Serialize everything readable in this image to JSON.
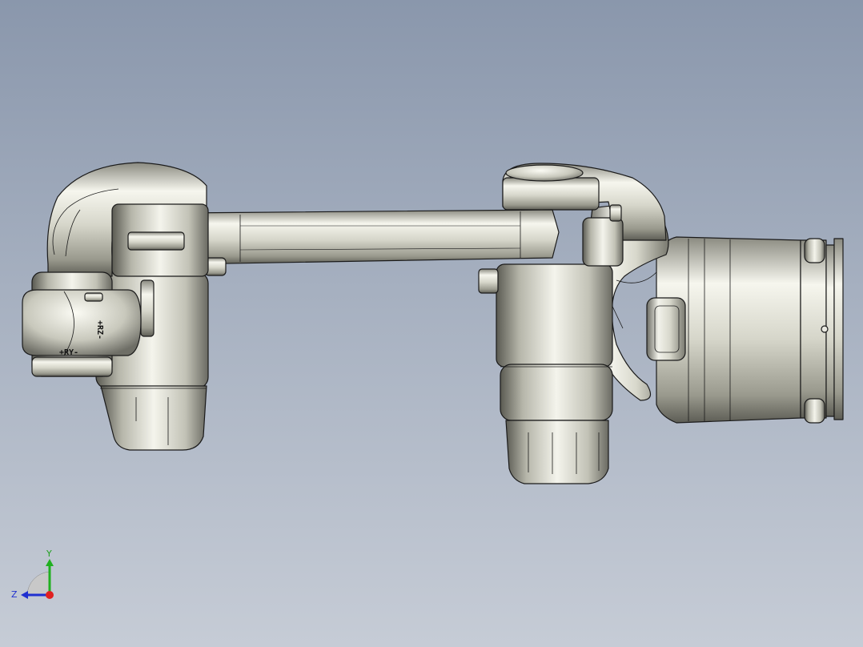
{
  "model": {
    "name": "robot-arm",
    "colors": {
      "metal_light": "#f4f4ec",
      "metal_mid": "#c9c9bd",
      "metal_dark": "#6f6f66",
      "edge": "#1a1a1a"
    },
    "wrist_labels": {
      "rz": "+RZ-",
      "ry": "+RY-"
    }
  },
  "triad": {
    "y_label": "Y",
    "z_label": "Z",
    "colors": {
      "x": "#e02020",
      "y": "#20b020",
      "z": "#2030d0"
    }
  }
}
